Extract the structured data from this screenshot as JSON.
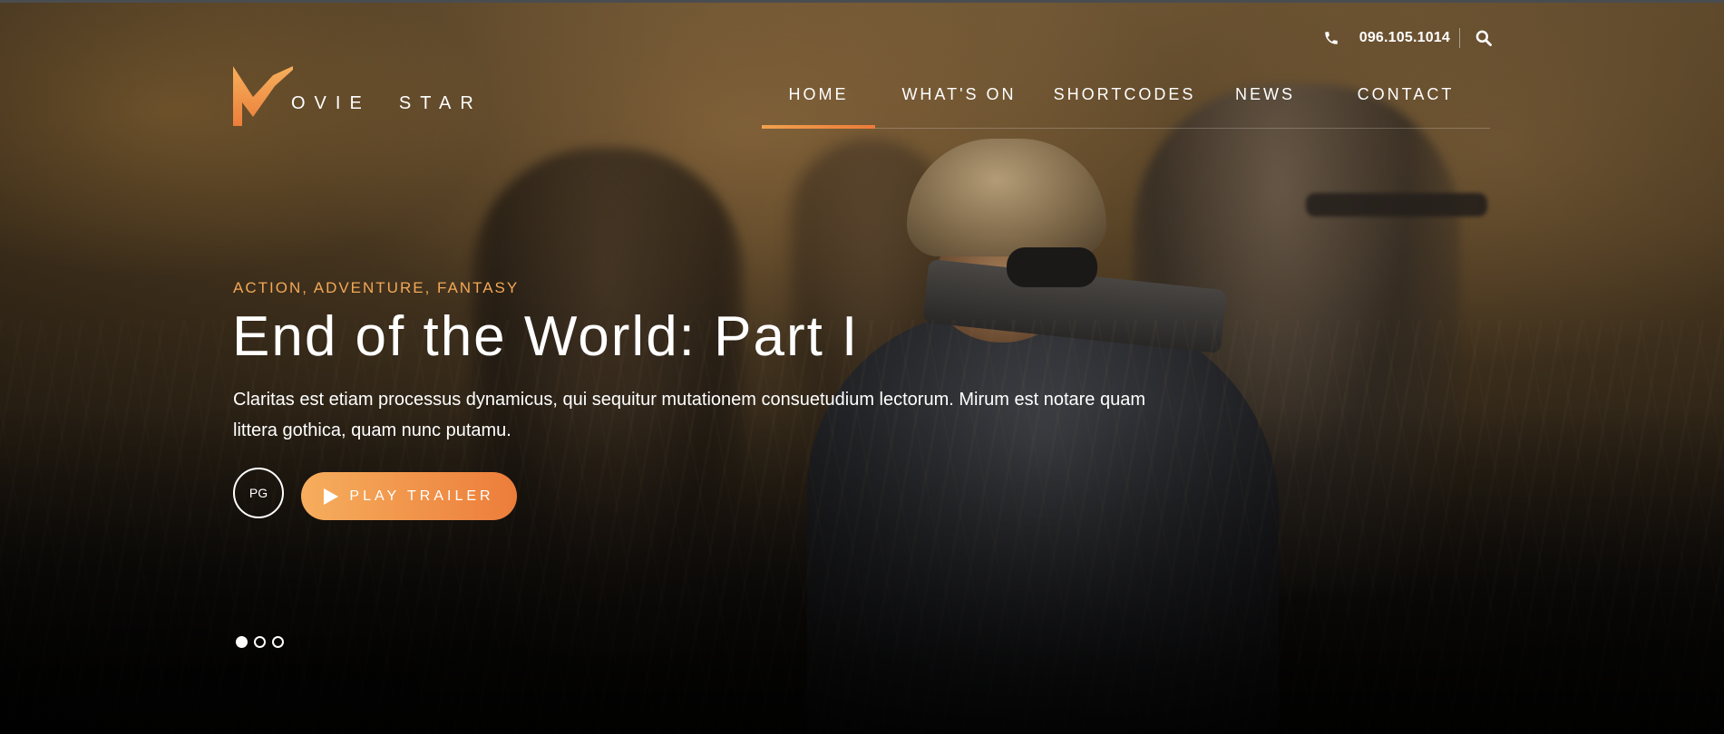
{
  "header": {
    "phone": "096.105.1014",
    "logo": {
      "initial": "M",
      "text": "OVIE  STAR"
    }
  },
  "nav": {
    "items": [
      {
        "label": "HOME",
        "active": true
      },
      {
        "label": "WHAT'S ON",
        "active": false
      },
      {
        "label": "SHORTCODES",
        "active": false
      },
      {
        "label": "NEWS",
        "active": false
      },
      {
        "label": "CONTACT",
        "active": false
      }
    ]
  },
  "hero": {
    "genres": "ACTION, ADVENTURE, FANTASY",
    "title": "End of the World: Part I",
    "description": "Claritas est etiam processus dynamicus, qui sequitur mutationem consuetudium lectorum. Mirum est notare quam littera gothica, quam nunc putamu.",
    "rating": "PG",
    "trailer_label": "PLAY TRAILER"
  },
  "slider": {
    "slide_count": 3,
    "active_index": 0
  },
  "colors": {
    "accent": "#f0a24e",
    "accent_end": "#ec7b3a",
    "text": "#ffffff"
  },
  "icons": {
    "phone": "phone-icon",
    "search": "search-icon",
    "play": "play-icon"
  }
}
